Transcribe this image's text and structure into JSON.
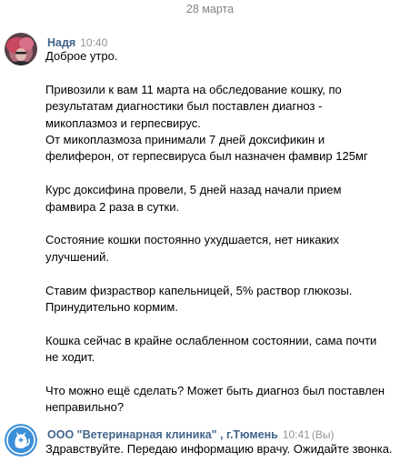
{
  "date_separator": "28 марта",
  "messages": [
    {
      "author": "Надя",
      "time": "10:40",
      "paragraphs": [
        [
          "Доброе утро."
        ],
        [
          "Привозили к вам 11 марта на обследование кошку, по",
          "результатам диагностики был поставлен диагноз -",
          "микоплазмоз и герпесвирус.",
          "От микоплазмоза принимали 7 дней доксификин и",
          "фелиферон, от герпесвируса был назначен фамвир 125мг"
        ],
        [
          "Курс доксифина провели, 5 дней назад начали прием",
          "фамвира 2 раза в сутки."
        ],
        [
          "Состояние кошки постоянно ухудшается, нет никаких",
          "улучшений."
        ],
        [
          "Ставим физраствор капельницей, 5% раствор глюкозы.",
          "Принудительно кормим."
        ],
        [
          "Кошка сейчас в крайне ослабленном состоянии, сама почти",
          "не ходит."
        ],
        [
          "Что можно ещё сделать? Может быть диагноз был поставлен",
          "неправильно?"
        ]
      ]
    },
    {
      "author": "ООО \"Ветеринарная клиника\" , г.Тюмень",
      "time": "10:41",
      "you_label": "(Вы)",
      "paragraphs": [
        [
          "Здравствуйте. Передаю информацию врачу. Ожидайте звонка."
        ]
      ]
    }
  ],
  "colors": {
    "author": "#42648b",
    "meta": "#939393",
    "clinic_logo": "#3c8fd9"
  }
}
